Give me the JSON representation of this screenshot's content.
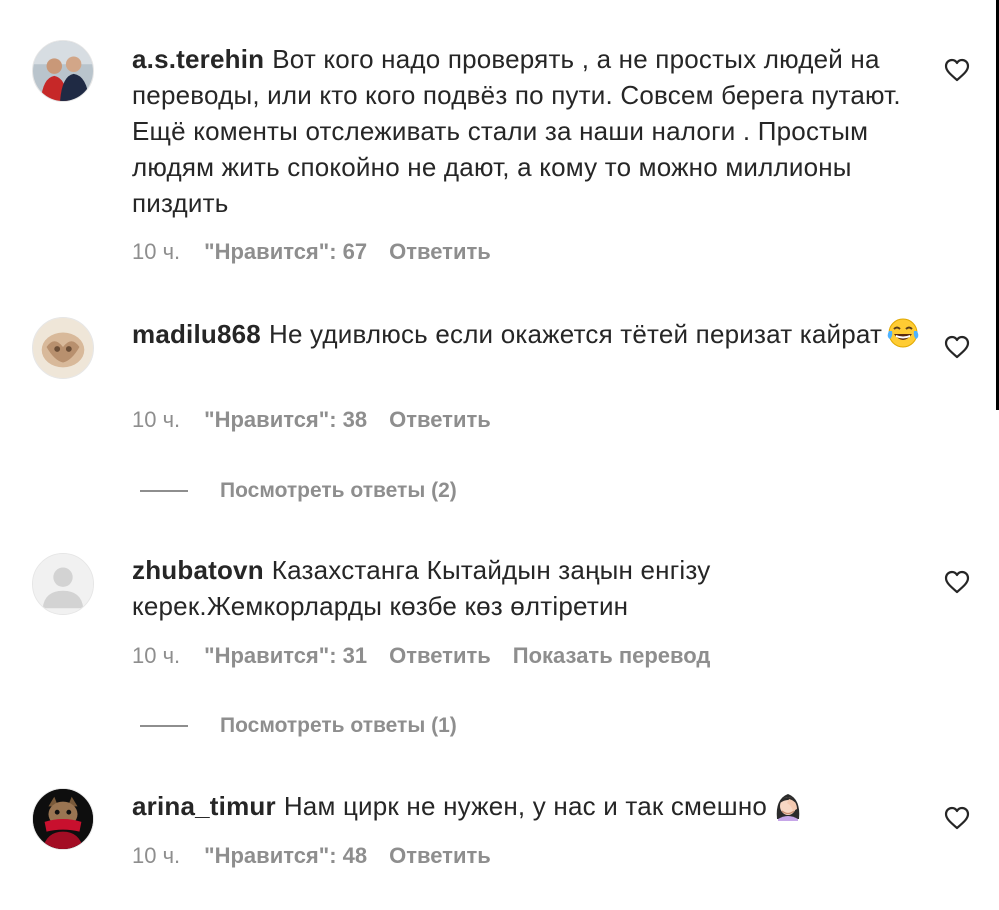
{
  "comments": [
    {
      "username": "a.s.terehin",
      "text": "Вот кого надо проверять , а не простых людей на переводы, или кто кого подвёз по пути. Совсем берега путают. Ещё коменты отслеживать стали за наши налоги . Простым людям жить спокойно не дают, а кому то можно миллионы пиздить",
      "time": "10 ч.",
      "likes": "\"Нравится\": 67",
      "reply": "Ответить"
    },
    {
      "username": "madilu868",
      "text": "Не удивлюсь если окажется тётей перизат кайрат",
      "emoji": "face-with-tears-of-joy",
      "time": "10 ч.",
      "likes": "\"Нравится\": 38",
      "reply": "Ответить",
      "view_replies": "Посмотреть ответы (2)"
    },
    {
      "username": "zhubatovn",
      "text": "Казахстанга Кытайдын заңын енгізу керек.Жемкорларды көзбе көз өлтіретин",
      "time": "10 ч.",
      "likes": "\"Нравится\": 31",
      "reply": "Ответить",
      "translate": "Показать перевод",
      "view_replies": "Посмотреть ответы (1)"
    },
    {
      "username": "arina_timur",
      "text": "Нам цирк не нужен, у нас и так смешно",
      "emoji": "woman-facepalming",
      "time": "10 ч.",
      "likes": "\"Нравится\": 48",
      "reply": "Ответить"
    }
  ],
  "icons": {
    "like": "heart-outline-icon"
  },
  "colors": {
    "text": "#262626",
    "muted": "#8e8e8e"
  }
}
